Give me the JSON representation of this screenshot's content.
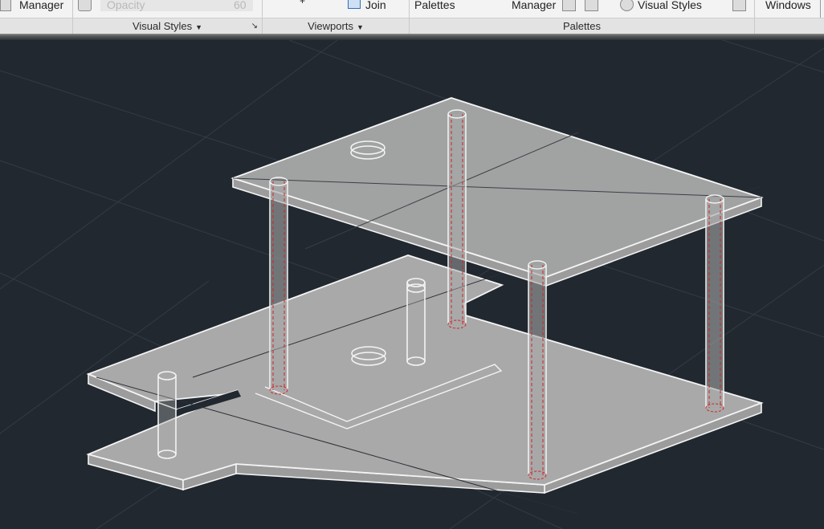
{
  "ribbon": {
    "panels": [
      {
        "name": "",
        "items": {
          "manager_label": "Manager"
        }
      },
      {
        "name": "Visual Styles",
        "items": {
          "opacity_label": "Opacity",
          "opacity_value": "60"
        }
      },
      {
        "name": "Viewports",
        "items": {
          "join_label": "Join"
        }
      },
      {
        "name": "Palettes",
        "items": {
          "palettes_label": "Palettes",
          "manager_label": "Manager",
          "visual_styles_label": "Visual Styles"
        }
      },
      {
        "name": "",
        "items": {
          "windows_label": "Windows"
        }
      }
    ]
  },
  "colors": {
    "viewport_bg": "#212830",
    "plate_fill": "#a9a9a9",
    "edge": "#f4f4f4",
    "hidden_line": "#d22222",
    "ribbon_bg": "#f3f3f3"
  },
  "model": {
    "description_visible": false
  }
}
